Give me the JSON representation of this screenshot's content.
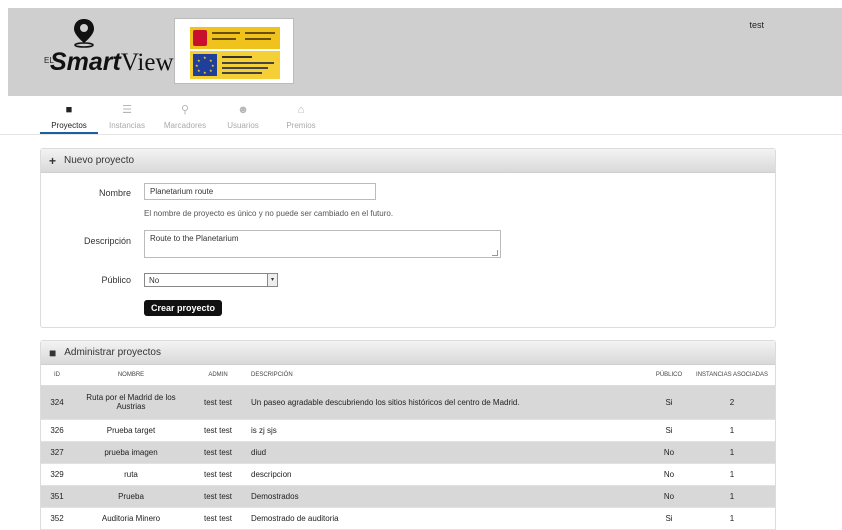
{
  "header": {
    "brand_prefix": "EL",
    "brand_bold": "Smart",
    "brand_rest": "View",
    "user": "test"
  },
  "tabs": [
    {
      "label": "Proyectos",
      "icon": "folder-icon",
      "active": true
    },
    {
      "label": "Instancias",
      "icon": "list-icon",
      "active": false
    },
    {
      "label": "Marcadores",
      "icon": "map-marker-icon",
      "active": false
    },
    {
      "label": "Usuarios",
      "icon": "users-icon",
      "active": false
    },
    {
      "label": "Premios",
      "icon": "gift-icon",
      "active": false
    }
  ],
  "new_project": {
    "title": "Nuevo proyecto",
    "name_label": "Nombre",
    "name_value": "Planetarium route",
    "name_help": "El nombre de proyecto es único y no puede ser cambiado en el futuro.",
    "desc_label": "Descripción",
    "desc_value": "Route to the Planetarium",
    "public_label": "Público",
    "public_value": "No",
    "create_label": "Crear proyecto"
  },
  "manage": {
    "title": "Administrar proyectos",
    "columns": [
      "ID",
      "NOMBRE",
      "ADMIN",
      "DESCRIPCIÓN",
      "PÚBLICO",
      "INSTANCIAS ASOCIADAS"
    ],
    "rows": [
      {
        "id": "324",
        "name": "Ruta por el Madrid de los Austrias",
        "admin": "test test",
        "desc": "Un paseo agradable descubriendo los sitios históricos del centro de Madrid.",
        "public": "Si",
        "instances": "2"
      },
      {
        "id": "326",
        "name": "Prueba target",
        "admin": "test test",
        "desc": "is zj sjs",
        "public": "Si",
        "instances": "1"
      },
      {
        "id": "327",
        "name": "prueba imagen",
        "admin": "test test",
        "desc": "diud",
        "public": "No",
        "instances": "1"
      },
      {
        "id": "329",
        "name": "ruta",
        "admin": "test test",
        "desc": "descripcion",
        "public": "No",
        "instances": "1"
      },
      {
        "id": "351",
        "name": "Prueba",
        "admin": "test test",
        "desc": "Demostrados",
        "public": "No",
        "instances": "1"
      },
      {
        "id": "352",
        "name": "Auditoria Minero",
        "admin": "test test",
        "desc": "Demostrado de auditoria",
        "public": "Si",
        "instances": "1"
      }
    ]
  }
}
